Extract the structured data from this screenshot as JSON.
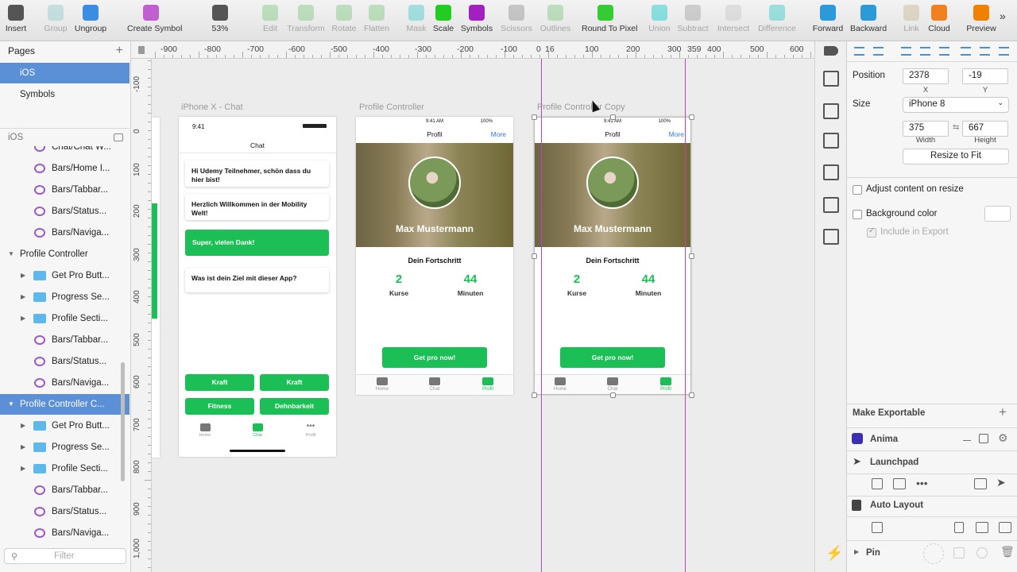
{
  "toolbar": {
    "items": [
      {
        "label": "Insert",
        "icon": "insert-icon",
        "enabled": true
      },
      {
        "label": "Group",
        "icon": "group-icon",
        "enabled": false
      },
      {
        "label": "Ungroup",
        "icon": "ungroup-icon",
        "enabled": true
      },
      {
        "label": "Create Symbol",
        "icon": "create-symbol-icon",
        "enabled": true
      },
      {
        "label": "53%",
        "icon": "zoom-icon",
        "enabled": true
      },
      {
        "label": "Edit",
        "icon": "edit-icon",
        "enabled": false
      },
      {
        "label": "Transform",
        "icon": "transform-icon",
        "enabled": false
      },
      {
        "label": "Rotate",
        "icon": "rotate-icon",
        "enabled": false
      },
      {
        "label": "Flatten",
        "icon": "flatten-icon",
        "enabled": false
      },
      {
        "label": "Mask",
        "icon": "mask-icon",
        "enabled": false
      },
      {
        "label": "Scale",
        "icon": "scale-icon",
        "enabled": true
      },
      {
        "label": "Symbols",
        "icon": "symbols-icon",
        "enabled": true
      },
      {
        "label": "Scissors",
        "icon": "scissors-icon",
        "enabled": false
      },
      {
        "label": "Outlines",
        "icon": "outlines-icon",
        "enabled": false
      },
      {
        "label": "Round To Pixel",
        "icon": "round-to-pixel-icon",
        "enabled": true
      },
      {
        "label": "Union",
        "icon": "union-icon",
        "enabled": false
      },
      {
        "label": "Subtract",
        "icon": "subtract-icon",
        "enabled": false
      },
      {
        "label": "Intersect",
        "icon": "intersect-icon",
        "enabled": false
      },
      {
        "label": "Difference",
        "icon": "difference-icon",
        "enabled": false
      },
      {
        "label": "Forward",
        "icon": "forward-icon",
        "enabled": true
      },
      {
        "label": "Backward",
        "icon": "backward-icon",
        "enabled": true
      },
      {
        "label": "Link",
        "icon": "link-icon",
        "enabled": false
      },
      {
        "label": "Cloud",
        "icon": "cloud-icon",
        "enabled": true
      },
      {
        "label": "Preview",
        "icon": "preview-icon",
        "enabled": true
      }
    ]
  },
  "left_panel": {
    "pages_title": "Pages",
    "pages": [
      "iOS",
      "Symbols"
    ],
    "current_page": "iOS",
    "filter_placeholder": "Filter",
    "layers": [
      {
        "label": "Chat/Chat W...",
        "type": "symbol",
        "indent": 2
      },
      {
        "label": "Bars/Home I...",
        "type": "symbol",
        "indent": 2
      },
      {
        "label": "Bars/Tabbar...",
        "type": "symbol",
        "indent": 2
      },
      {
        "label": "Bars/Status...",
        "type": "symbol",
        "indent": 2
      },
      {
        "label": "Bars/Naviga...",
        "type": "symbol",
        "indent": 2
      },
      {
        "label": "Profile Controller",
        "type": "artboard",
        "indent": 1
      },
      {
        "label": "Get Pro Butt...",
        "type": "folder",
        "indent": 2
      },
      {
        "label": "Progress Se...",
        "type": "folder",
        "indent": 2
      },
      {
        "label": "Profile Secti...",
        "type": "folder",
        "indent": 2
      },
      {
        "label": "Bars/Tabbar...",
        "type": "symbol",
        "indent": 2
      },
      {
        "label": "Bars/Status...",
        "type": "symbol",
        "indent": 2
      },
      {
        "label": "Bars/Naviga...",
        "type": "symbol",
        "indent": 2
      },
      {
        "label": "Profile Controller C...",
        "type": "artboard",
        "indent": 1,
        "selected": true
      },
      {
        "label": "Get Pro Butt...",
        "type": "folder",
        "indent": 2
      },
      {
        "label": "Progress Se...",
        "type": "folder",
        "indent": 2
      },
      {
        "label": "Profile Secti...",
        "type": "folder",
        "indent": 2
      },
      {
        "label": "Bars/Tabbar...",
        "type": "symbol",
        "indent": 2
      },
      {
        "label": "Bars/Status...",
        "type": "symbol",
        "indent": 2
      },
      {
        "label": "Bars/Naviga...",
        "type": "symbol",
        "indent": 2
      }
    ]
  },
  "ruler_top": [
    "-900",
    "-800",
    "-700",
    "-600",
    "-500",
    "-400",
    "-300",
    "-200",
    "-100",
    "0",
    "16",
    "100",
    "200",
    "300",
    "359",
    "400",
    "500",
    "600"
  ],
  "ruler_left": [
    "-100",
    "0",
    "100",
    "200",
    "300",
    "400",
    "500",
    "600",
    "700",
    "800",
    "900",
    "1,000"
  ],
  "canvas": {
    "chat": {
      "artboard_label": "iPhone X - Chat",
      "time": "9:41",
      "title": "Chat",
      "messages": [
        "Hi Udemy Teilnehmer, schön dass du hier bist!",
        "Herzlich Willkommen in der Mobility Welt!",
        "Super, vielen Dank!",
        "Was ist dein Ziel mit dieser App?"
      ],
      "options": [
        "Kraft",
        "Kraft",
        "Fitness",
        "Dehnbarkeit"
      ],
      "tabs": [
        "Home",
        "Chat",
        "Profil"
      ]
    },
    "profile": {
      "artboard_label": "Profile Controller",
      "status_time": "9:41 AM",
      "battery": "100%",
      "title": "Profil",
      "more": "More",
      "name": "Max Mustermann",
      "progress_title": "Dein Fortschritt",
      "stat1_value": "2",
      "stat1_label": "Kurse",
      "stat2_value": "44",
      "stat2_label": "Minuten",
      "cta": "Get pro now!",
      "tabs": [
        "Home",
        "Chat",
        "Profil"
      ]
    },
    "profile_copy": {
      "artboard_label": "Profile Controller Copy"
    }
  },
  "inspector": {
    "position_label": "Position",
    "x": "2378",
    "y": "-19",
    "x_label": "X",
    "y_label": "Y",
    "size_label": "Size",
    "size_preset": "iPhone 8",
    "width": "375",
    "height": "667",
    "width_label": "Width",
    "height_label": "Height",
    "resize_button": "Resize to Fit",
    "adjust_content": "Adjust content on resize",
    "background_color": "Background color",
    "include_export": "Include in Export",
    "make_exportable": "Make Exportable",
    "plugins": [
      "Anima",
      "Launchpad",
      "Auto Layout",
      "Pin"
    ]
  },
  "colors": {
    "accent": "#5b8fd6",
    "green": "#1bbf55",
    "guide": "#c040c0"
  }
}
